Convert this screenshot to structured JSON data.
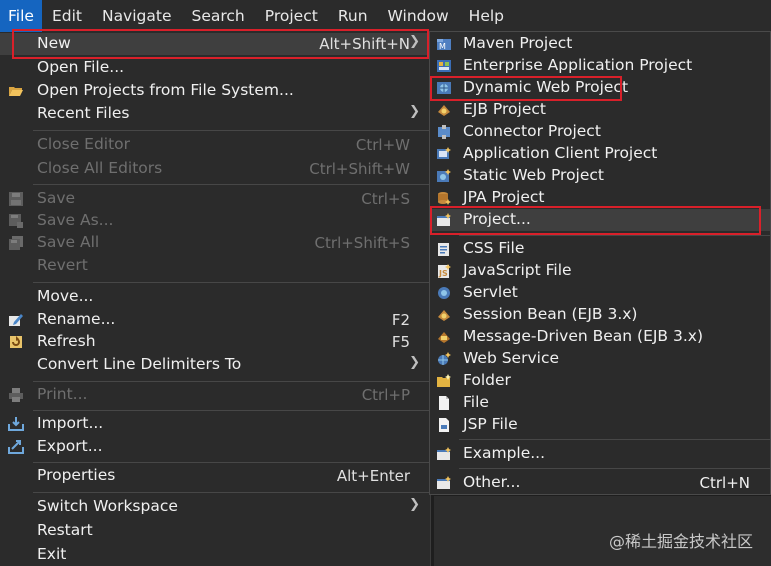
{
  "menubar": {
    "items": [
      "File",
      "Edit",
      "Navigate",
      "Search",
      "Project",
      "Run",
      "Window",
      "Help"
    ]
  },
  "file_menu": {
    "new": {
      "label": "New",
      "accel": "Alt+Shift+N"
    },
    "open_file": {
      "label": "Open File..."
    },
    "open_projects": {
      "label": "Open Projects from File System..."
    },
    "recent_files": {
      "label": "Recent Files"
    },
    "close_editor": {
      "label": "Close Editor",
      "accel": "Ctrl+W"
    },
    "close_all_editors": {
      "label": "Close All Editors",
      "accel": "Ctrl+Shift+W"
    },
    "save": {
      "label": "Save",
      "accel": "Ctrl+S"
    },
    "save_as": {
      "label": "Save As..."
    },
    "save_all": {
      "label": "Save All",
      "accel": "Ctrl+Shift+S"
    },
    "revert": {
      "label": "Revert"
    },
    "move": {
      "label": "Move..."
    },
    "rename": {
      "label": "Rename...",
      "accel": "F2"
    },
    "refresh": {
      "label": "Refresh",
      "accel": "F5"
    },
    "convert_line": {
      "label": "Convert Line Delimiters To"
    },
    "print": {
      "label": "Print...",
      "accel": "Ctrl+P"
    },
    "import": {
      "label": "Import..."
    },
    "export": {
      "label": "Export..."
    },
    "properties": {
      "label": "Properties",
      "accel": "Alt+Enter"
    },
    "switch_workspace": {
      "label": "Switch Workspace"
    },
    "restart": {
      "label": "Restart"
    },
    "exit": {
      "label": "Exit"
    }
  },
  "new_submenu": {
    "maven_project": "Maven Project",
    "enterprise_app_project": "Enterprise Application Project",
    "dynamic_web_project": "Dynamic Web Project",
    "ejb_project": "EJB Project",
    "connector_project": "Connector Project",
    "app_client_project": "Application Client Project",
    "static_web_project": "Static Web Project",
    "jpa_project": "JPA Project",
    "project": "Project...",
    "css_file": "CSS File",
    "javascript_file": "JavaScript File",
    "servlet": "Servlet",
    "session_bean": "Session Bean (EJB 3.x)",
    "message_driven_bean": "Message-Driven Bean (EJB 3.x)",
    "web_service": "Web Service",
    "folder": "Folder",
    "file": "File",
    "jsp_file": "JSP File",
    "example": "Example...",
    "other": {
      "label": "Other...",
      "accel": "Ctrl+N"
    }
  },
  "watermark": "@稀土掘金技术社区",
  "colors": {
    "menubar_active": "#1565c0",
    "highlight_box": "#d9202a",
    "menu_bg": "#2b2b2b"
  }
}
